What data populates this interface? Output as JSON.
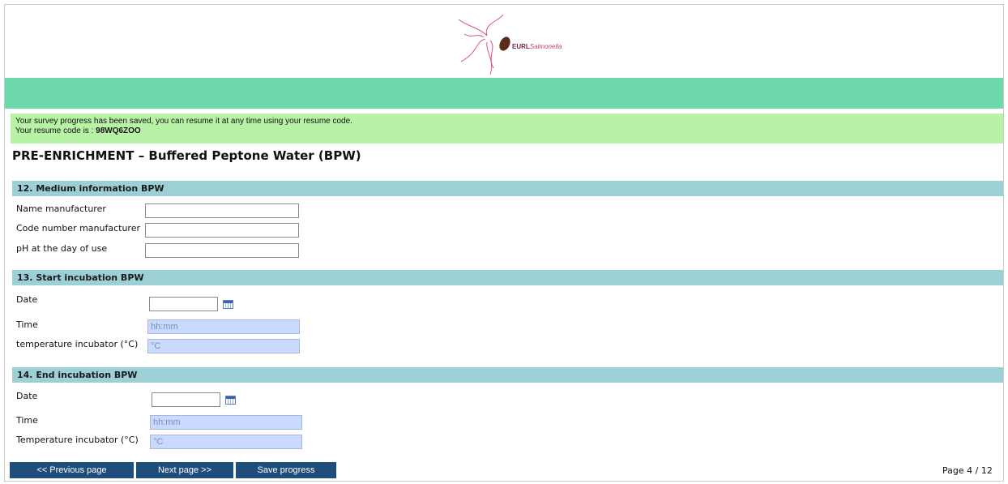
{
  "header": {
    "logo_text_bold": "EURL",
    "logo_text_italic": "Salmonella",
    "logo_colors": {
      "bacterium": "#5a2a1a",
      "flagella": "#e0508a"
    }
  },
  "notice": {
    "line1": "Your survey progress has been saved, you can resume it at any time using your resume code.",
    "line2_prefix": "Your resume code is : ",
    "resume_code": "98WQ6ZOO"
  },
  "page_title": "PRE-ENRICHMENT – Buffered Peptone Water (BPW)",
  "sections": [
    {
      "title": "12. Medium information BPW",
      "fields": [
        {
          "label": "Name manufacturer",
          "value": "",
          "placeholder": ""
        },
        {
          "label": "Code number manufacturer",
          "value": "",
          "placeholder": ""
        },
        {
          "label": "pH at the day of use",
          "value": "",
          "placeholder": ""
        }
      ]
    },
    {
      "title": "13. Start incubation BPW",
      "fields": [
        {
          "label": "Date",
          "value": "",
          "placeholder": ""
        },
        {
          "label": "Time",
          "value": "",
          "placeholder": "hh:mm"
        },
        {
          "label": "temperature incubator (°C)",
          "value": "",
          "placeholder": "°C"
        }
      ]
    },
    {
      "title": "14. End incubation BPW",
      "fields": [
        {
          "label": "Date",
          "value": "",
          "placeholder": ""
        },
        {
          "label": "Time",
          "value": "",
          "placeholder": "hh:mm"
        },
        {
          "label": "Temperature incubator (°C)",
          "value": "",
          "placeholder": "°C"
        }
      ]
    }
  ],
  "footer": {
    "prev_label": "<< Previous page",
    "next_label": "Next page >>",
    "save_label": "Save progress",
    "page_indicator": "Page 4 / 12"
  },
  "colors": {
    "green_band": "#6fd9ad",
    "notice_bg": "#b8f2a6",
    "section_bg": "#9ccfd6",
    "button_bg": "#1f4d7c",
    "time_input_bg": "#c9d9ff"
  },
  "icons": {
    "date_picker": "calendar-icon"
  }
}
